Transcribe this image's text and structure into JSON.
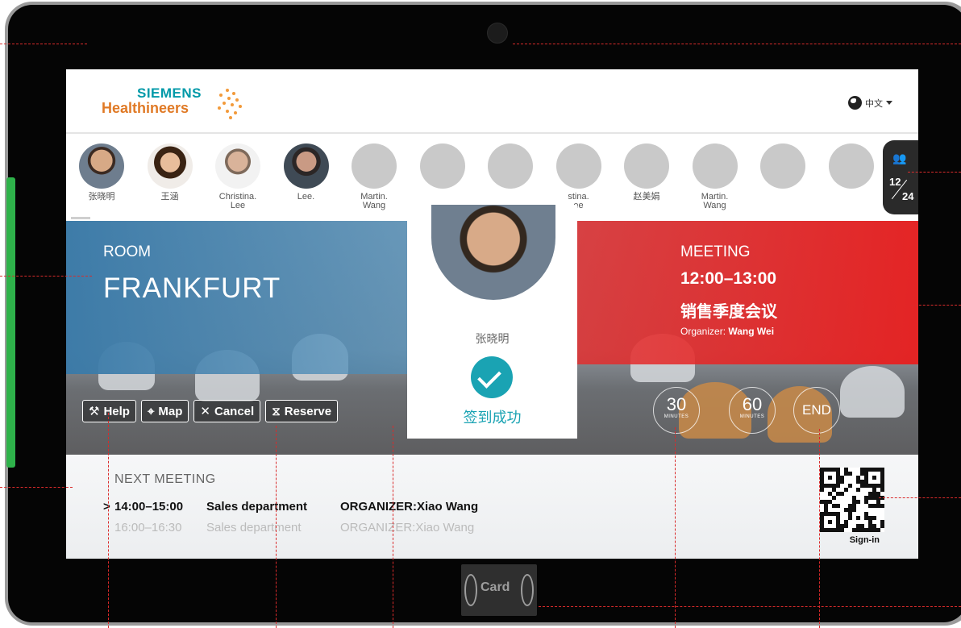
{
  "brand": {
    "name_top": "SIEMENS",
    "name_bottom": "Healthineers"
  },
  "language": {
    "label": "中文"
  },
  "attendees": [
    {
      "name": "张晓明",
      "photo": true
    },
    {
      "name": "王涵",
      "photo": true
    },
    {
      "name": "Christina.\nLee",
      "photo": true
    },
    {
      "name": "Lee.",
      "photo": true
    },
    {
      "name": "Martin.\nWang",
      "photo": false
    },
    {
      "name": "",
      "photo": false
    },
    {
      "name": "",
      "photo": false
    },
    {
      "name": "stina.\nee",
      "photo": false
    },
    {
      "name": "赵美娟",
      "photo": false
    },
    {
      "name": "Martin.\nWang",
      "photo": false
    },
    {
      "name": "",
      "photo": false
    },
    {
      "name": "",
      "photo": false
    }
  ],
  "attendee_count": {
    "checked_in": "12",
    "total": "24"
  },
  "room": {
    "label": "ROOM",
    "name": "FRANKFURT"
  },
  "meeting": {
    "label": "MEETING",
    "time": "12:00–13:00",
    "title": "销售季度会议",
    "organizer_label": "Organizer:",
    "organizer_name": "Wang Wei"
  },
  "actions": [
    {
      "key": "help",
      "label": "Help",
      "icon": "wrench-icon"
    },
    {
      "key": "map",
      "label": "Map",
      "icon": "map-pin-icon"
    },
    {
      "key": "cancel",
      "label": "Cancel",
      "icon": "close-icon"
    },
    {
      "key": "reserve",
      "label": "Reserve",
      "icon": "hourglass-icon"
    }
  ],
  "timers": [
    {
      "key": "30",
      "value": "30",
      "unit": "MINUTES"
    },
    {
      "key": "60",
      "value": "60",
      "unit": "MINUTES"
    },
    {
      "key": "end",
      "value": "END",
      "unit": ""
    }
  ],
  "checkin": {
    "name": "张晓明",
    "status": "签到成功"
  },
  "next_meeting": {
    "heading": "NEXT  MEETING",
    "rows": [
      {
        "marker": ">",
        "time": "14:00–15:00",
        "dept": "Sales department",
        "organizer": "ORGANIZER:Xiao Wang",
        "active": true
      },
      {
        "marker": "",
        "time": "16:00–16:30",
        "dept": "Sales department",
        "organizer": "ORGANIZER:Xiao Wang",
        "active": false
      }
    ]
  },
  "signin": {
    "label": "Sign-in"
  },
  "card_reader": {
    "label": "Card"
  },
  "colors": {
    "brand_teal": "#0099a8",
    "brand_orange": "#e07a26",
    "room_blue": "#3a7aa8",
    "meeting_red": "#e42c2c",
    "success_teal": "#1aa3b3",
    "callout_red": "#d92b2b"
  }
}
